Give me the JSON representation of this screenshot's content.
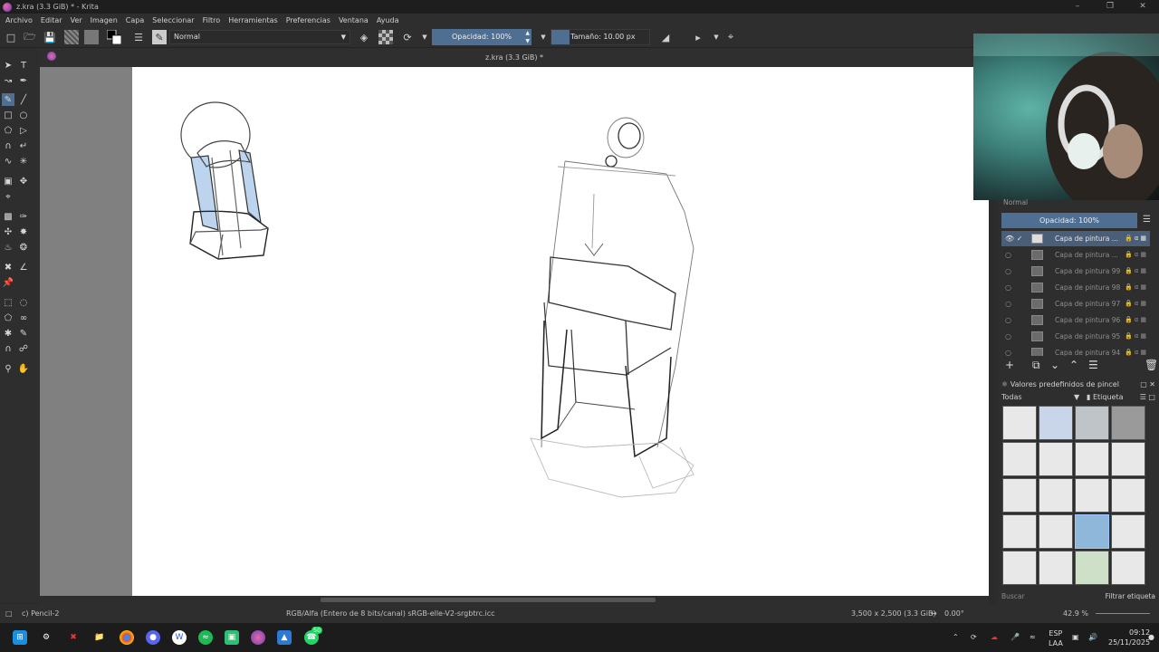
{
  "window": {
    "title": "z.kra (3.3 GiB) * - Krita"
  },
  "menu": [
    "Archivo",
    "Editar",
    "Ver",
    "Imagen",
    "Capa",
    "Seleccionar",
    "Filtro",
    "Herramientas",
    "Preferencias",
    "Ventana",
    "Ayuda"
  ],
  "toolbar": {
    "blend_mode": "Normal",
    "opacity_label": "Opacidad: 100%",
    "opacity": 1.0,
    "size_label": "Tamaño: 10.00 px"
  },
  "document": {
    "tab_title": "z.kra (3.3 GiB) *"
  },
  "layers": {
    "blend_mode": "Normal",
    "opacity_label": "Opacidad: 100%",
    "items": [
      {
        "name": "Capa de pintura ...",
        "active": true
      },
      {
        "name": "Capa de pintura ...",
        "active": false
      },
      {
        "name": "Capa de pintura 99",
        "active": false
      },
      {
        "name": "Capa de pintura 98",
        "active": false
      },
      {
        "name": "Capa de pintura 97",
        "active": false
      },
      {
        "name": "Capa de pintura 96",
        "active": false
      },
      {
        "name": "Capa de pintura 95",
        "active": false
      },
      {
        "name": "Capa de pintura 94",
        "active": false
      }
    ]
  },
  "brush_presets": {
    "title": "Valores predefinidos de pincel",
    "filter": "Todas",
    "tag_label": "Etiqueta",
    "search_placeholder": "Buscar",
    "filter_tag_label": "Filtrar etiqueta",
    "selected_index": 14
  },
  "status": {
    "brush": "c) Pencil-2",
    "color_space": "RGB/Alfa (Entero de 8 bits/canal)  sRGB-elle-V2-srgbtrc.icc",
    "image_size": "3,500 x 2,500 (3.3 GiB)",
    "rotation": "0.00°",
    "zoom": "42.9 %"
  },
  "taskbar": {
    "lang": "ESP",
    "lang2": "LAA",
    "time": "09:12",
    "date": "25/11/2025",
    "whatsapp_badge": "50"
  },
  "colors": {
    "accent": "#4f6f92",
    "panel": "#2e2e2e",
    "canvas_bg": "#808080"
  }
}
